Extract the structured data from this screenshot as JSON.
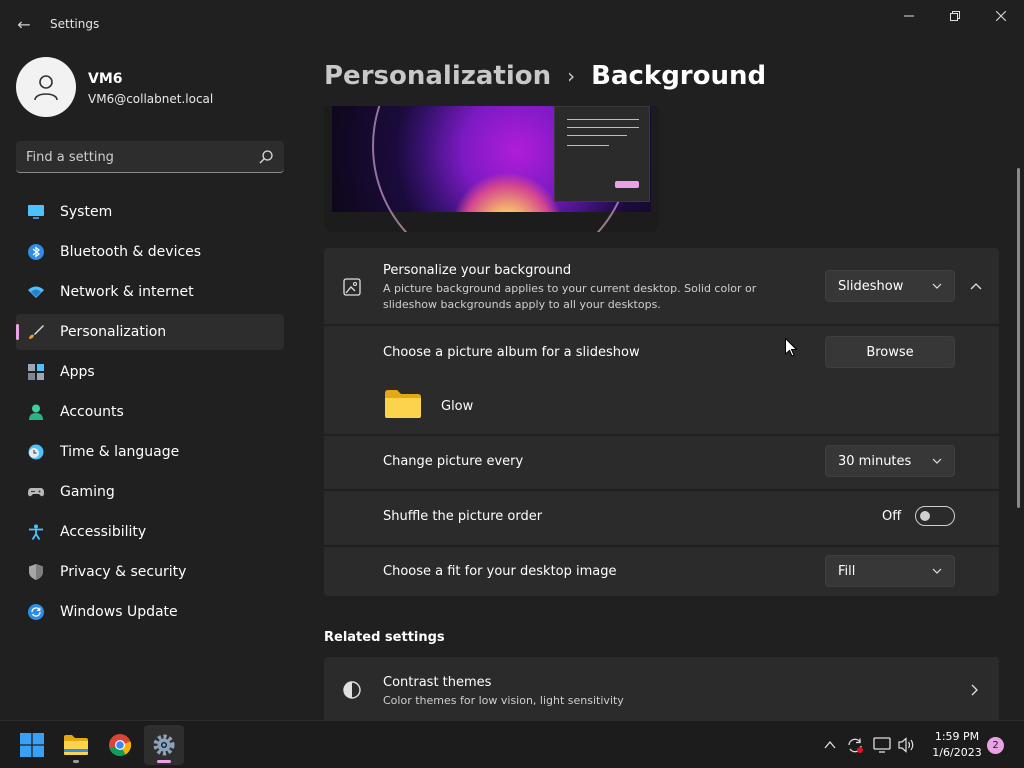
{
  "window": {
    "title": "Settings"
  },
  "profile": {
    "name": "VM6",
    "email": "VM6@collabnet.local"
  },
  "search": {
    "placeholder": "Find a setting"
  },
  "sidebar": {
    "items": [
      {
        "label": "System",
        "icon": "monitor-icon"
      },
      {
        "label": "Bluetooth & devices",
        "icon": "bluetooth-icon"
      },
      {
        "label": "Network & internet",
        "icon": "wifi-icon"
      },
      {
        "label": "Personalization",
        "icon": "brush-icon",
        "active": true
      },
      {
        "label": "Apps",
        "icon": "apps-icon"
      },
      {
        "label": "Accounts",
        "icon": "person-icon"
      },
      {
        "label": "Time & language",
        "icon": "clock-globe-icon"
      },
      {
        "label": "Gaming",
        "icon": "gamepad-icon"
      },
      {
        "label": "Accessibility",
        "icon": "accessibility-icon"
      },
      {
        "label": "Privacy & security",
        "icon": "shield-icon"
      },
      {
        "label": "Windows Update",
        "icon": "update-icon"
      }
    ]
  },
  "breadcrumb": {
    "parent": "Personalization",
    "separator": "›",
    "current": "Background"
  },
  "background": {
    "title": "Personalize your background",
    "description_line1": "A picture background applies to your current desktop. Solid color or",
    "description_line2": "slideshow backgrounds apply to all your desktops.",
    "type_value": "Slideshow"
  },
  "album": {
    "label": "Choose a picture album for a slideshow",
    "browse_label": "Browse",
    "folder_name": "Glow"
  },
  "interval": {
    "label": "Change picture every",
    "value": "30 minutes"
  },
  "shuffle": {
    "label": "Shuffle the picture order",
    "state_label": "Off",
    "on": false
  },
  "fit": {
    "label": "Choose a fit for your desktop image",
    "value": "Fill"
  },
  "related": {
    "title": "Related settings",
    "contrast_title": "Contrast themes",
    "contrast_desc": "Color themes for low vision, light sensitivity"
  },
  "taskbar": {
    "time": "1:59 PM",
    "date": "1/6/2023",
    "notifications": "2"
  },
  "colors": {
    "accent": "#e9a2e6",
    "background": "#202020",
    "card": "#2b2b2b"
  }
}
